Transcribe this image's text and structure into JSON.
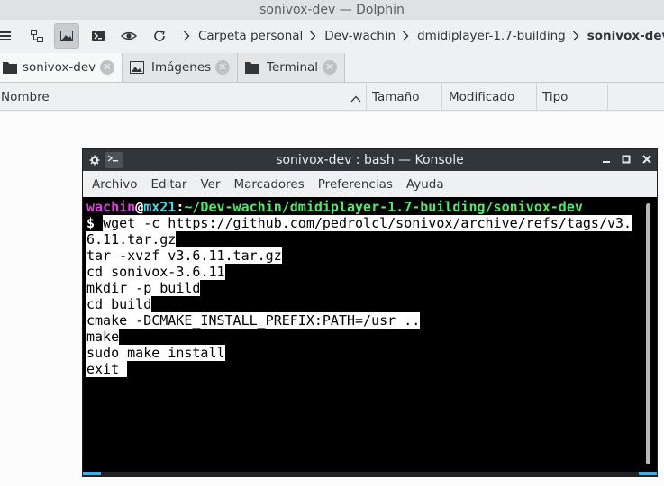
{
  "dolphin": {
    "title": "sonivox-dev — Dolphin",
    "breadcrumb": [
      "Carpeta personal",
      "Dev-wachin",
      "dmidiplayer-1.7-building",
      "sonivox-dev"
    ],
    "tabs": [
      {
        "label": "sonivox-dev",
        "icon": "folder-icon"
      },
      {
        "label": "Imágenes",
        "icon": "image-folder-icon"
      },
      {
        "label": "Terminal",
        "icon": "folder-icon"
      }
    ],
    "columns": [
      "Nombre",
      "Tamaño",
      "Modificado",
      "Tipo"
    ]
  },
  "konsole": {
    "title": "sonivox-dev : bash — Konsole",
    "menu": [
      "Archivo",
      "Editar",
      "Ver",
      "Marcadores",
      "Preferencias",
      "Ayuda"
    ],
    "prompt": {
      "user": "wachin",
      "at": "@",
      "host": "mx21",
      "colon": ":",
      "path": "~/Dev-wachin/dmidiplayer-1.7-building/sonivox-dev",
      "symbol": "$"
    },
    "lines": [
      "wget -c https://github.com/pedrolcl/sonivox/archive/refs/tags/v3.",
      "6.11.tar.gz",
      "tar -xvzf v3.6.11.tar.gz",
      "cd sonivox-3.6.11",
      "mkdir -p build",
      "cd build",
      "cmake -DCMAKE_INSTALL_PREFIX:PATH=/usr ..",
      "make",
      "sudo make install",
      "exit "
    ]
  },
  "colors": {
    "accent": "#3daee9",
    "terminal_bg": "#000000",
    "selection_bg": "#ffffff"
  }
}
